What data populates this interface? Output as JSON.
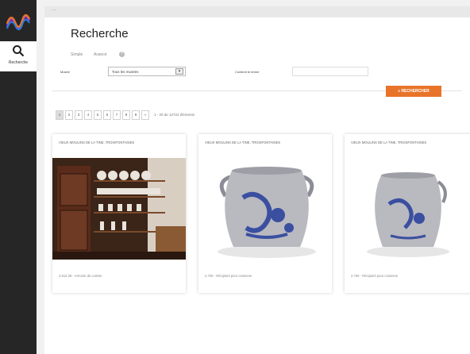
{
  "sidebar": {
    "logo_icon": "wave-logo",
    "nav": [
      {
        "label": "Recherche",
        "icon": "search-icon"
      }
    ]
  },
  "topbar": {
    "breadcrumb": "—"
  },
  "page": {
    "title": "Recherche"
  },
  "modes": {
    "simple": "Simple",
    "avance": "Avancé",
    "help": "?"
  },
  "form": {
    "musee_label": "Musée",
    "musee_value": "Tous les musées",
    "contient_label": "Contient le terme",
    "contient_value": "",
    "search_button": "⌕ RECHERCHER"
  },
  "pager": {
    "pages": [
      "1",
      "2",
      "3",
      "4",
      "5",
      "6",
      "7",
      "8",
      "9",
      "»"
    ],
    "info": "1 - 20 de 12722 éléments"
  },
  "cards": [
    {
      "title": "VIEUX MOULINS DE LA TINE, TROISFONTAINES",
      "caption": "2.513.38 - Armoire de cuisine",
      "image": "kitchen-cabinet"
    },
    {
      "title": "VIEUX MOULINS DE LA TINE, TROISFONTAINES",
      "caption": "2.700 - Récipient pour conserve",
      "image": "stoneware-jar"
    },
    {
      "title": "VIEUX MOULINS DE LA TINE, TROISFONTAINES",
      "caption": "2.700 - Récipient pour conserve",
      "image": "stoneware-jar"
    }
  ],
  "colors": {
    "accent": "#e8742a",
    "sidebar": "#262626",
    "pottery_blue": "#3a4fa0"
  }
}
